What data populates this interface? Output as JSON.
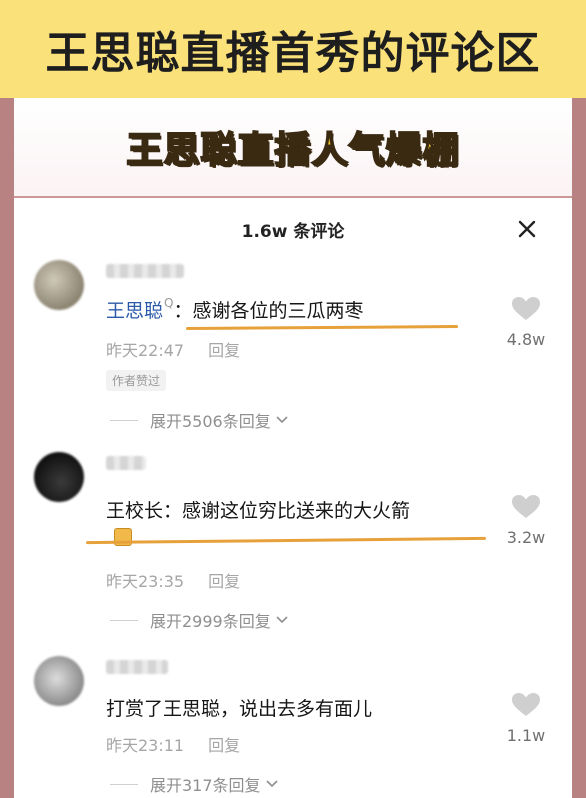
{
  "top_title": "王思聪直播首秀的评论区",
  "headline": "王思聪直播人气爆棚",
  "sheet": {
    "title": "1.6w 条评论",
    "close_symbol": "✕"
  },
  "comments": [
    {
      "author_prefix": "王思聪",
      "search_mark": "Q",
      "text": "：感谢各位的三瓜两枣",
      "time": "昨天22:47",
      "reply_label": "回复",
      "badge": "作者赞过",
      "expand": "展开5506条回复",
      "likes": "4.8w"
    },
    {
      "author_prefix": "王校长",
      "text": "：感谢这位穷比送来的大火箭",
      "time": "昨天23:35",
      "reply_label": "回复",
      "expand": "展开2999条回复",
      "likes": "3.2w"
    },
    {
      "text": "打赏了王思聪，说出去多有面儿",
      "time": "昨天23:11",
      "reply_label": "回复",
      "expand": "展开317条回复",
      "likes": "1.1w"
    }
  ],
  "colors": {
    "banner": "#fae17a",
    "accent_underline": "#e7a13b",
    "name_blue": "#2b5aa8",
    "headline_yellow": "#f3c12c"
  },
  "icons": [
    "close-icon",
    "heart-icon",
    "chevron-down-icon",
    "search-icon"
  ]
}
